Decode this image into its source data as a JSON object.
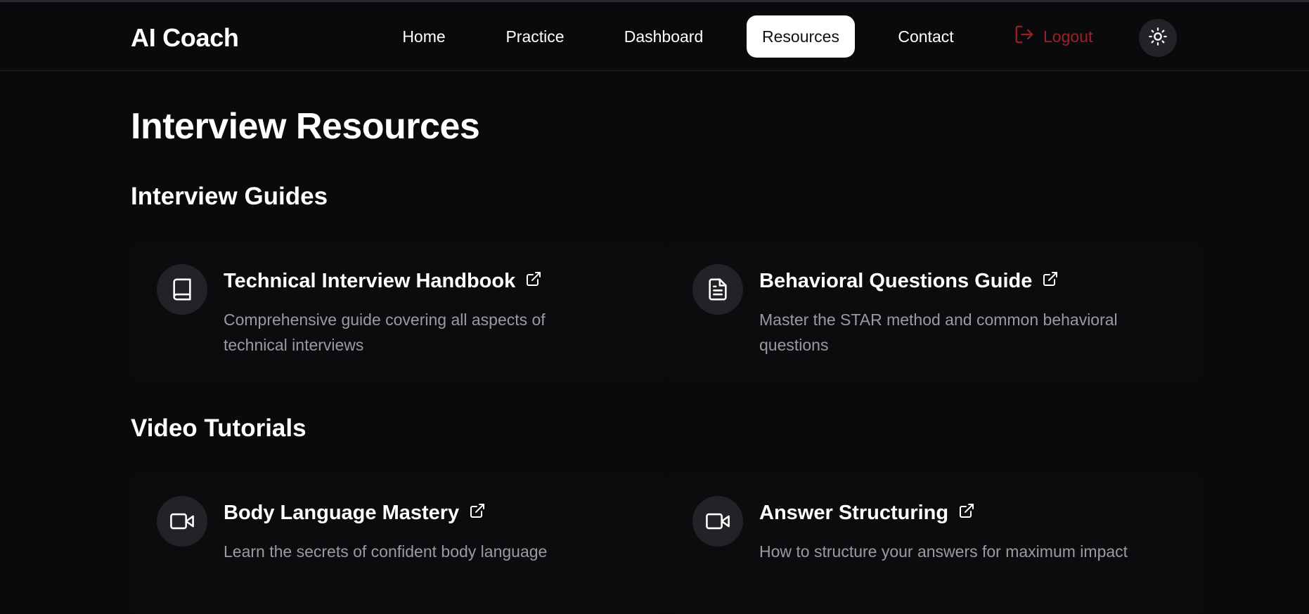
{
  "nav": {
    "brand": "AI Coach",
    "items": [
      {
        "label": "Home"
      },
      {
        "label": "Practice"
      },
      {
        "label": "Dashboard"
      },
      {
        "label": "Resources",
        "active": true
      },
      {
        "label": "Contact"
      }
    ],
    "logout_label": "Logout",
    "theme_icon": "sun-icon"
  },
  "page": {
    "title": "Interview Resources"
  },
  "sections": [
    {
      "title": "Interview Guides",
      "cards": [
        {
          "icon": "book-icon",
          "title": "Technical Interview Handbook",
          "description": "Comprehensive guide covering all aspects of technical interviews"
        },
        {
          "icon": "document-icon",
          "title": "Behavioral Questions Guide",
          "description": "Master the STAR method and common behavioral questions"
        }
      ]
    },
    {
      "title": "Video Tutorials",
      "cards": [
        {
          "icon": "video-icon",
          "title": "Body Language Mastery",
          "description": "Learn the secrets of confident body language"
        },
        {
          "icon": "video-icon",
          "title": "Answer Structuring",
          "description": "How to structure your answers for maximum impact"
        }
      ]
    }
  ],
  "colors": {
    "background": "#0a0a0c",
    "logout": "#9b2226",
    "muted_text": "#9a9aa2",
    "icon_bg": "#232327"
  }
}
